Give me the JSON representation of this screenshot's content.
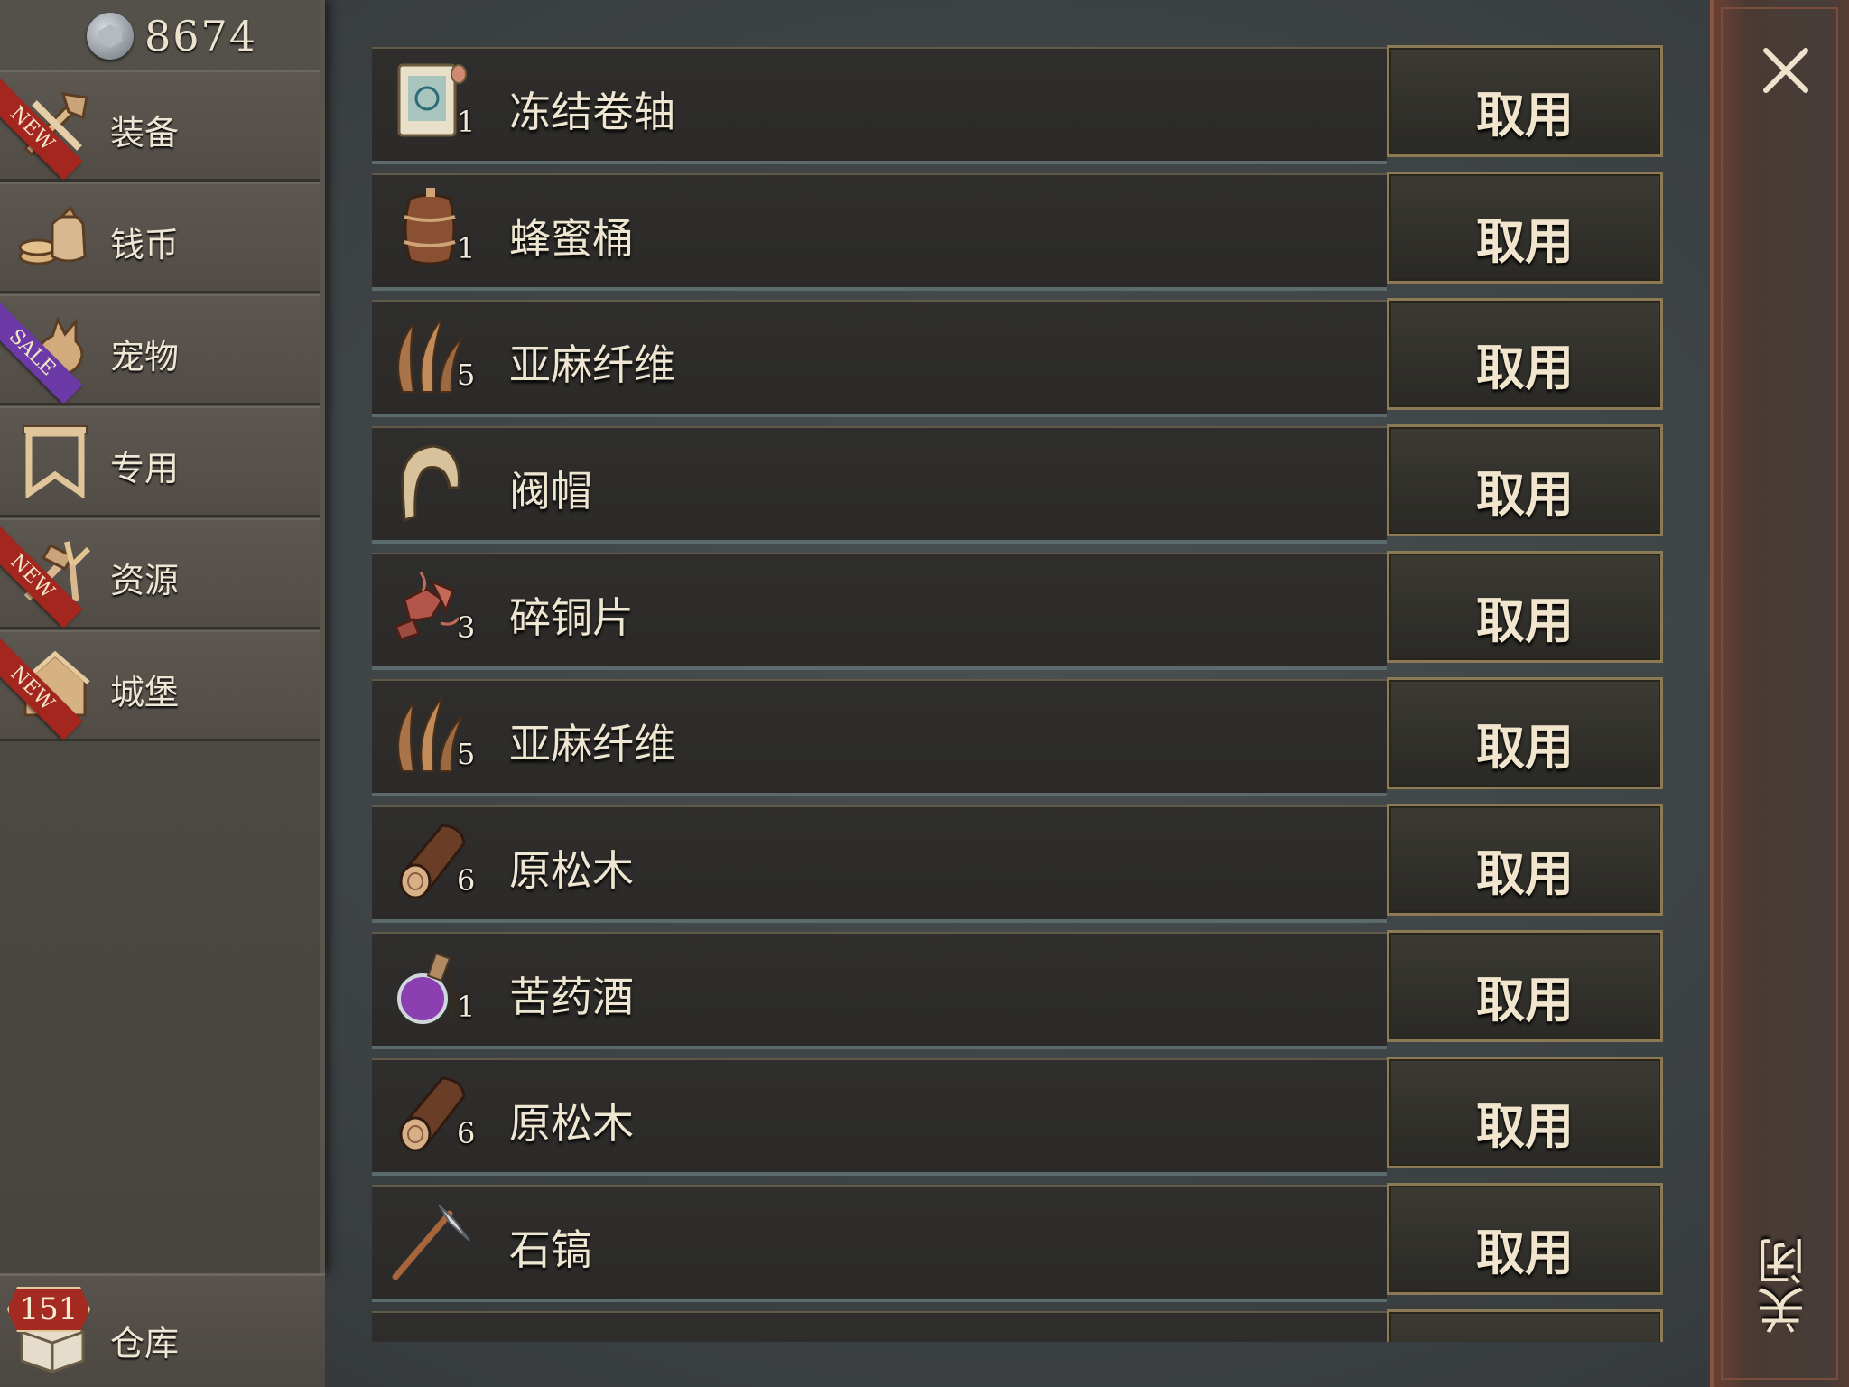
{
  "currency": {
    "icon": "silver-coin-icon",
    "value": "8674"
  },
  "sidebar": {
    "items": [
      {
        "label": "装备",
        "icon": "equipment-icon",
        "ribbon": "NEW",
        "ribbon_type": "new"
      },
      {
        "label": "钱币",
        "icon": "coins-icon",
        "ribbon": "",
        "ribbon_type": ""
      },
      {
        "label": "宠物",
        "icon": "pet-icon",
        "ribbon": "SALE",
        "ribbon_type": "sale"
      },
      {
        "label": "专用",
        "icon": "banner-icon",
        "ribbon": "",
        "ribbon_type": ""
      },
      {
        "label": "资源",
        "icon": "resources-icon",
        "ribbon": "NEW",
        "ribbon_type": "new"
      },
      {
        "label": "城堡",
        "icon": "castle-icon",
        "ribbon": "NEW",
        "ribbon_type": "new"
      }
    ]
  },
  "warehouse": {
    "label": "仓库",
    "count": "151",
    "icon": "warehouse-box-icon"
  },
  "items": [
    {
      "name": "冻结卷轴",
      "qty": "1",
      "icon": "scroll-icon",
      "action": "取用"
    },
    {
      "name": "蜂蜜桶",
      "qty": "1",
      "icon": "barrel-icon",
      "action": "取用"
    },
    {
      "name": "亚麻纤维",
      "qty": "5",
      "icon": "flax-fiber-icon",
      "action": "取用"
    },
    {
      "name": "阀帽",
      "qty": "",
      "icon": "hood-icon",
      "action": "取用"
    },
    {
      "name": "碎铜片",
      "qty": "3",
      "icon": "copper-scraps-icon",
      "action": "取用"
    },
    {
      "name": "亚麻纤维",
      "qty": "5",
      "icon": "flax-fiber-icon",
      "action": "取用"
    },
    {
      "name": "原松木",
      "qty": "6",
      "icon": "pine-log-icon",
      "action": "取用"
    },
    {
      "name": "苦药酒",
      "qty": "1",
      "icon": "potion-icon",
      "action": "取用"
    },
    {
      "name": "原松木",
      "qty": "6",
      "icon": "pine-log-icon",
      "action": "取用"
    },
    {
      "name": "石镐",
      "qty": "",
      "icon": "stone-pickaxe-icon",
      "action": "取用"
    }
  ],
  "close": {
    "label": "关闭",
    "icon": "close-icon"
  },
  "colors": {
    "ribbon_new": "#a3271f",
    "ribbon_sale": "#6b3aa6",
    "button_border": "#8c7a55",
    "close_panel": "#5a3b32"
  }
}
